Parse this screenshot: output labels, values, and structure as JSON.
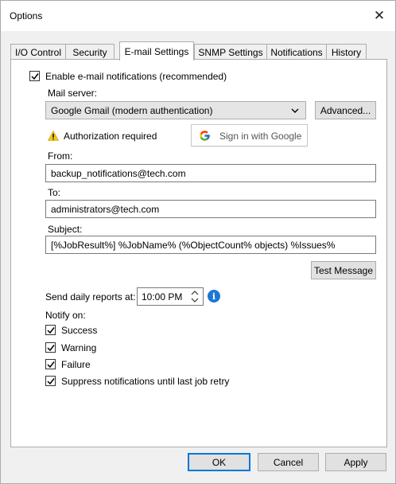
{
  "window": {
    "title": "Options",
    "close_glyph": "✕"
  },
  "tabs": [
    {
      "label": "I/O Control"
    },
    {
      "label": "Security"
    },
    {
      "label": "E-mail Settings"
    },
    {
      "label": "SNMP Settings"
    },
    {
      "label": "Notifications"
    },
    {
      "label": "History"
    }
  ],
  "active_tab": "E-mail Settings",
  "email": {
    "enable_label": "Enable e-mail notifications (recommended)",
    "enable_checked": true,
    "mail_server_label": "Mail server:",
    "mail_server_value": "Google Gmail (modern authentication)",
    "advanced_label": "Advanced...",
    "auth_text": "Authorization required",
    "google_signin_label": "Sign in with Google",
    "from_label": "From:",
    "from_value": "backup_notifications@tech.com",
    "to_label": "To:",
    "to_value": "administrators@tech.com",
    "subject_label": "Subject:",
    "subject_value": "[%JobResult%] %JobName% (%ObjectCount% objects) %Issues%",
    "test_message_label": "Test Message",
    "daily_label": "Send daily reports at:",
    "daily_time": "10:00 PM",
    "notify_on_label": "Notify on:",
    "notify_options": [
      {
        "label": "Success",
        "checked": true
      },
      {
        "label": "Warning",
        "checked": true
      },
      {
        "label": "Failure",
        "checked": true
      },
      {
        "label": "Suppress notifications until last job retry",
        "checked": true
      }
    ]
  },
  "footer": {
    "ok_label": "OK",
    "cancel_label": "Cancel",
    "apply_label": "Apply"
  },
  "colors": {
    "accent": "#0078d7",
    "info": "#1b77d3",
    "warning": "#f5c518"
  },
  "icons": {
    "close": "close-icon",
    "check": "checkmark-icon",
    "warning": "warning-icon",
    "google": "google-logo-icon",
    "chevron": "chevron-down-icon",
    "spinner": "spinner-updown-icon",
    "info": "info-icon"
  }
}
